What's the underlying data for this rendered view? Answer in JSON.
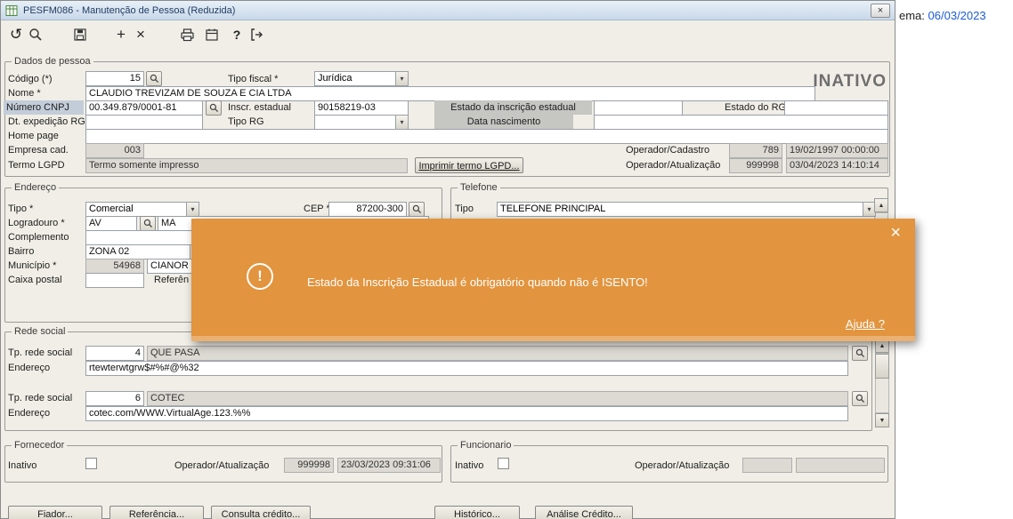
{
  "window": {
    "title": "PESFM086 - Manutenção de Pessoa (Reduzida)",
    "close_glyph": "×"
  },
  "header_right": {
    "prefix": "ema:",
    "date": "06/03/2023"
  },
  "toolbar": {
    "undo_glyph": "↺",
    "add_glyph": "+",
    "delete_glyph": "×",
    "help_glyph": "?"
  },
  "glyphs": {
    "combo_arrow": "▾",
    "scroll_up": "▲",
    "scroll_down": "▼"
  },
  "dados_pessoa": {
    "legend": "Dados de pessoa",
    "inativo_stamp": "INATIVO",
    "codigo": {
      "label": "Código (*)",
      "value": "15"
    },
    "tipo_fiscal": {
      "label": "Tipo fiscal *",
      "value": "Jurídica"
    },
    "nome": {
      "label": "Nome *",
      "value": "CLAUDIO TREVIZAM DE SOUZA E CIA LTDA"
    },
    "numero_cnpj": {
      "label": "Número CNPJ",
      "value": "00.349.879/0001-81"
    },
    "inscr_estadual": {
      "label": "Inscr. estadual",
      "value": "90158219-03"
    },
    "estado_inscricao": {
      "label": "Estado da inscrição estadual",
      "value": ""
    },
    "estado_rg": {
      "label": "Estado do RG",
      "value": ""
    },
    "dt_expedicao_rg": {
      "label": "Dt. expedição RG",
      "value": ""
    },
    "tipo_rg": {
      "label": "Tipo RG",
      "value": ""
    },
    "data_nascimento": {
      "label": "Data nascimento",
      "value": ""
    },
    "home_page": {
      "label": "Home page",
      "value": ""
    },
    "empresa_cad": {
      "label": "Empresa cad.",
      "value": "003"
    },
    "operador_cadastro": {
      "label": "Operador/Cadastro",
      "id": "789",
      "timestamp": "19/02/1997 00:00:00"
    },
    "termo_lgpd": {
      "label": "Termo LGPD",
      "value": "Termo somente impresso",
      "button": "Imprimir termo LGPD..."
    },
    "operador_atualizacao": {
      "label": "Operador/Atualização",
      "id": "999998",
      "timestamp": "03/04/2023 14:10:14"
    }
  },
  "endereco": {
    "legend": "Endereço",
    "tipo": {
      "label": "Tipo *",
      "value": "Comercial"
    },
    "cep": {
      "label": "CEP *",
      "value": "87200-300"
    },
    "logradouro": {
      "label": "Logradouro *",
      "tipo": "AV",
      "value": "MA"
    },
    "complemento": {
      "label": "Complemento",
      "value": ""
    },
    "bairro": {
      "label": "Bairro",
      "value": "ZONA 02"
    },
    "municipio": {
      "label": "Município *",
      "code": "54968",
      "value": "CIANOR"
    },
    "caixa_postal": {
      "label": "Caixa postal",
      "value": ""
    },
    "referencia": {
      "label": "Referên"
    }
  },
  "telefone": {
    "legend": "Telefone",
    "tipo": {
      "label": "Tipo",
      "value": "TELEFONE PRINCIPAL"
    }
  },
  "rede_social": {
    "legend": "Rede social",
    "items": [
      {
        "tp_label": "Tp. rede social",
        "tp_value": "4",
        "nome": "QUE PASA",
        "endereco_label": "Endereço",
        "endereco": "rtewterwtgrw$#%#@%32"
      },
      {
        "tp_label": "Tp. rede social",
        "tp_value": "6",
        "nome": "COTEC",
        "endereco_label": "Endereço",
        "endereco": "cotec.com/WWW.VirtualAge.123.%%"
      }
    ]
  },
  "fornecedor": {
    "legend": "Fornecedor",
    "inativo_label": "Inativo",
    "operador": {
      "label": "Operador/Atualização",
      "id": "999998",
      "timestamp": "23/03/2023 09:31:06"
    }
  },
  "funcionario": {
    "legend": "Funcionario",
    "inativo_label": "Inativo",
    "operador": {
      "label": "Operador/Atualização",
      "id": "",
      "timestamp": ""
    }
  },
  "bottom_buttons": [
    "Fiador...",
    "Referência...",
    "Consulta crédito...",
    "Histórico...",
    "Análise Crédito..."
  ],
  "modal": {
    "message": "Estado da Inscrição Estadual é obrigatório quando não é ISENTO!",
    "help_link": "Ajuda ?",
    "close_glyph": "×",
    "icon_glyph": "!",
    "background": "#E2943E"
  }
}
